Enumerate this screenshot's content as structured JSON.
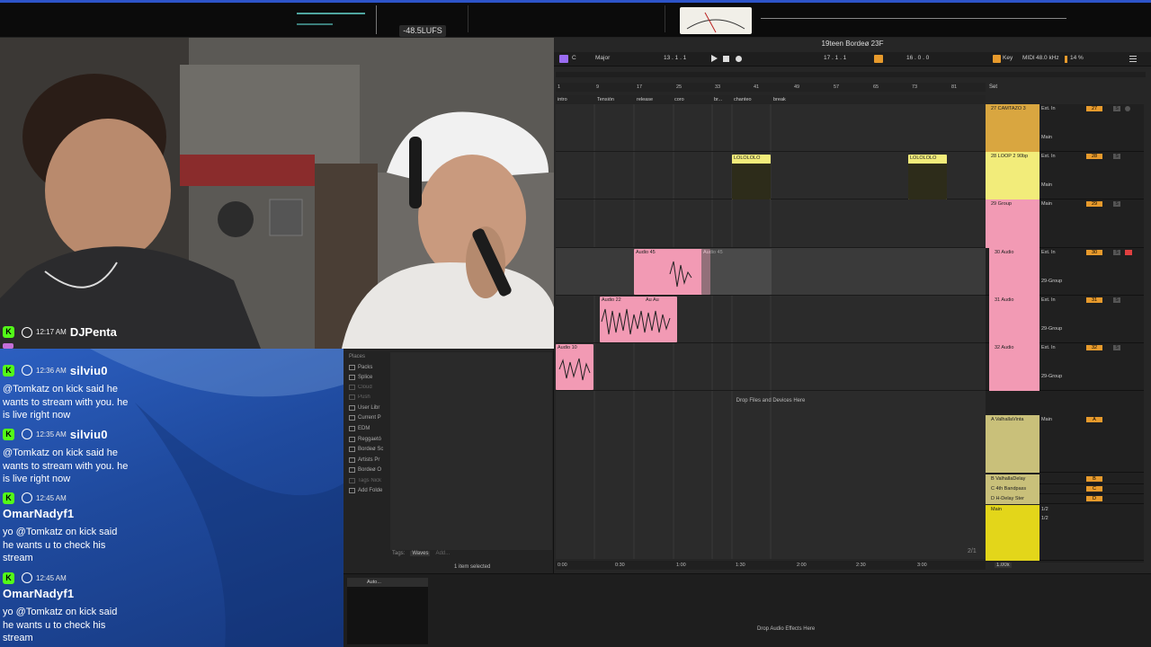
{
  "topbar": {
    "lufs_readout": "-48.5LUFS"
  },
  "daw": {
    "title": "19teen Bordeø 23F",
    "transport": {
      "key_root": "C",
      "key_scale": "Major",
      "position": "13 . 1 . 1",
      "loop_start": "17 . 1 . 1",
      "loop_length": "16 . 0 . 0",
      "key_label": "Key",
      "midi_label": "MIDI",
      "sample_rate": "48.0 kHz",
      "cpu": "14 %"
    },
    "ruler_bars": [
      "1",
      "9",
      "17",
      "25",
      "33",
      "41",
      "49",
      "57",
      "65",
      "73",
      "81"
    ],
    "locators": [
      "intro",
      "Tensión",
      "release",
      "coro",
      "br...",
      "chanteo",
      "break"
    ],
    "set_label": "Set",
    "time_marks": [
      "0:00",
      "0:30",
      "1:00",
      "1:30",
      "2:00",
      "2:30",
      "3:00"
    ],
    "drop_files": "Drop Files and Devices Here",
    "page_indicator": "2/1",
    "zoom": "1.00x",
    "tracks": [
      {
        "name": "27 CAMTAZO 3",
        "input": "Ext. In",
        "output": "Main",
        "volume": "27",
        "color": "#d9a640"
      },
      {
        "name": "28 LOOP 2 90bp",
        "input": "Ext. In",
        "output": "Main",
        "volume": "28",
        "color": "#f2ec7a"
      },
      {
        "name": "29 Group",
        "input": "Main",
        "output": "",
        "volume": "29",
        "color": "#f29ab4"
      },
      {
        "name": "30 Audio",
        "input": "Ext. In",
        "output": "29-Group",
        "volume": "30",
        "color": "#f29ab4"
      },
      {
        "name": "31 Audio",
        "input": "Ext. In",
        "output": "29-Group",
        "volume": "31",
        "color": "#f29ab4"
      },
      {
        "name": "32 Audio",
        "input": "Ext. In",
        "output": "29-Group",
        "volume": "32",
        "color": "#f29ab4"
      }
    ],
    "returns": [
      {
        "name": "A ValhallaVinta",
        "output": "Main",
        "letter": "A"
      },
      {
        "name": "B ValhallaDelay",
        "letter": "B"
      },
      {
        "name": "C 4th Bandpass",
        "letter": "C"
      },
      {
        "name": "D H-Delay Ster",
        "letter": "D"
      }
    ],
    "master": {
      "name": "Main",
      "routing_top": "1/2",
      "routing_bottom": "1/2"
    },
    "clips": {
      "loop": "LOLOLOLO",
      "audio45": "Audio 45",
      "audio45b": "Audio 45",
      "audio22": "Audio 22",
      "audio_au": "Au Au",
      "audio10": "Audio 10"
    }
  },
  "browser": {
    "places_header": "Places",
    "items": [
      "Packs",
      "Splice",
      "Cloud",
      "Push",
      "User Libr",
      "Current P",
      "EDM",
      "Reggaetó",
      "Bordeø Sc",
      "Artists Pr",
      "Bordeø O",
      "Tags Nick",
      "Add Folde"
    ],
    "tags_label": "Tags:",
    "tag_waves": "Waves",
    "tag_add": "Add...",
    "selection": "1 item selected"
  },
  "device_view": {
    "drop_label": "Drop Audio Effects Here",
    "device_name": "Auto..."
  },
  "webcam": {
    "timestamp": "12:17 AM",
    "streamer": "DJPenta"
  },
  "chat": {
    "messages": [
      {
        "time": "12:36 AM",
        "user": "silviu0",
        "text": "@Tomkatz on kick said he wants to stream with you. he is live right now"
      },
      {
        "time": "12:35 AM",
        "user": "silviu0",
        "text": "@Tomkatz on kick said he wants to stream with you. he is live right now"
      },
      {
        "time": "12:45 AM",
        "user": "OmarNadyf1",
        "text": "yo @Tomkatz on kick said he wants u to check his stream"
      },
      {
        "time": "12:45 AM",
        "user": "OmarNadyf1",
        "text": "yo @Tomkatz on kick said he wants u to check his stream"
      }
    ]
  }
}
